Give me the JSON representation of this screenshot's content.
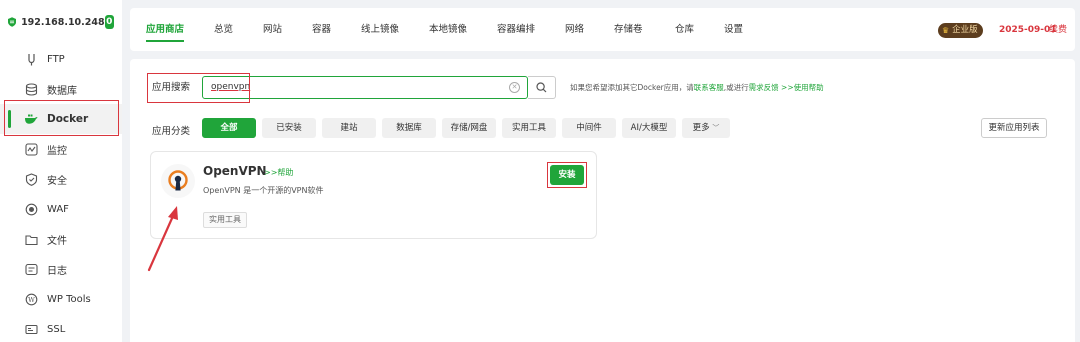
{
  "server": {
    "ip": "192.168.10.248",
    "count": "0"
  },
  "sidebar": {
    "items": [
      {
        "label": "FTP",
        "icon": "ftp-icon"
      },
      {
        "label": "数据库",
        "icon": "database-icon"
      },
      {
        "label": "Docker",
        "icon": "docker-icon",
        "active": true
      },
      {
        "label": "监控",
        "icon": "monitor-icon"
      },
      {
        "label": "安全",
        "icon": "security-icon"
      },
      {
        "label": "WAF",
        "icon": "waf-icon"
      },
      {
        "label": "文件",
        "icon": "folder-icon"
      },
      {
        "label": "日志",
        "icon": "log-icon"
      },
      {
        "label": "WP Tools",
        "icon": "wordpress-icon"
      },
      {
        "label": "SSL",
        "icon": "ssl-icon"
      }
    ]
  },
  "topnav": {
    "tabs": [
      "应用商店",
      "总览",
      "网站",
      "容器",
      "线上镜像",
      "本地镜像",
      "容器编排",
      "网络",
      "存储卷",
      "仓库",
      "设置"
    ],
    "active": "应用商店",
    "edition": "企业版",
    "expire_date": "2025-09-01",
    "renew": "续费"
  },
  "search": {
    "label": "应用搜索",
    "value": "openvpn",
    "hint_prefix": "如果您希望添加其它Docker应用，请",
    "hint_link1": "联系客服",
    "hint_mid": ",或进行",
    "hint_link2": "需求反馈",
    "hint_help": ">>使用帮助"
  },
  "categories": {
    "label": "应用分类",
    "items": [
      "全部",
      "已安装",
      "建站",
      "数据库",
      "存储/网盘",
      "实用工具",
      "中间件",
      "AI/大模型",
      "更多"
    ],
    "active": "全部",
    "update_label": "更新应用列表"
  },
  "app_card": {
    "name": "OpenVPN",
    "help": ">>帮助",
    "description": "OpenVPN 是一个开源的VPN软件",
    "tag": "实用工具",
    "install": "安装"
  },
  "colors": {
    "accent": "#20a53a",
    "highlight": "#d9363e"
  }
}
